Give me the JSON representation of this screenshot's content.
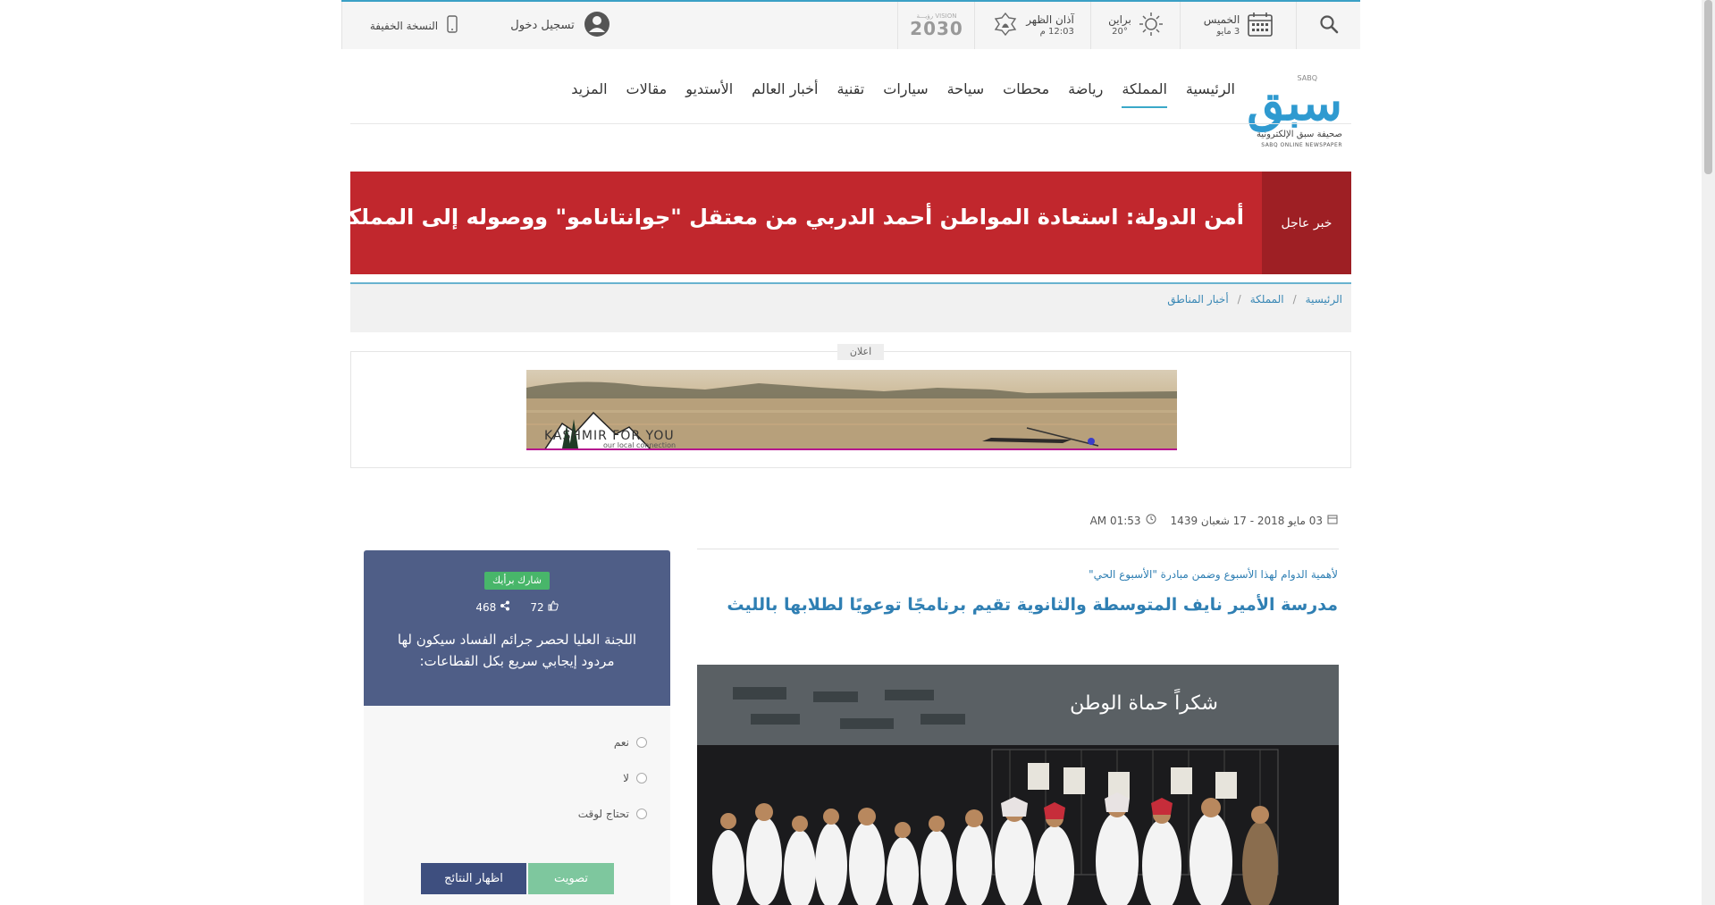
{
  "topbar": {
    "lite_version": "النسخة الخفيفة",
    "login": "تسجيل دخول",
    "vision_label": "رؤيـــة VISION",
    "vision_year": "2030",
    "prayer_title": "آذان الظهر",
    "prayer_time": "12:03 م",
    "weather_city": "براين",
    "weather_temp": "20°",
    "day_name": "الخميس",
    "day_date": "3 مايو"
  },
  "logo": {
    "arabic": "سبق",
    "tag": "SABQ",
    "subtitle": "صحيفة سبق الإلكترونية",
    "english": "SABQ ONLINE NEWSPAPER"
  },
  "nav": {
    "items": [
      "الرئيسية",
      "المملكة",
      "رياضة",
      "محطات",
      "سياحة",
      "سيارات",
      "تقنية",
      "أخبار العالم",
      "الأستديو",
      "مقالات",
      "المزيد"
    ],
    "active": "المملكة"
  },
  "breaking": {
    "label": "خبر عاجل",
    "text": "أمن الدولة: استعادة المواطن أحمد الدربي من معتقل \"جوانتانامو\" ووصوله إلى المملكة"
  },
  "breadcrumb": {
    "items": [
      "الرئيسية",
      "المملكة",
      "أخبار المناطق"
    ],
    "separator": "/"
  },
  "ad": {
    "label": "اعلان",
    "brand": "KASHMIR FOR YOU",
    "brand_sub": "our local connection"
  },
  "article": {
    "date": "03 مايو 2018 - 17 شعبان 1439",
    "time": "AM 01:53",
    "kicker": "لأهمية الدوام لهذا الأسبوع وضمن مبادرة \"الأسبوع الحي\"",
    "headline": "مدرسة الأمير نايف المتوسطة والثانوية تقيم برنامجًا توعويًا لطلابها بالليث",
    "photo_banner": "شكراً حماة الوطن"
  },
  "poll": {
    "share_label": "شارك برأيك",
    "likes": "72",
    "shares": "468",
    "question": "اللجنة العليا لحصر جرائم الفساد سيكون لها مردود إيجابي سريع بكل القطاعات:",
    "options": [
      "نعم",
      "لا",
      "تحتاج لوقت"
    ],
    "vote_button": "تصويت",
    "results_button": "اظهار النتائج"
  }
}
